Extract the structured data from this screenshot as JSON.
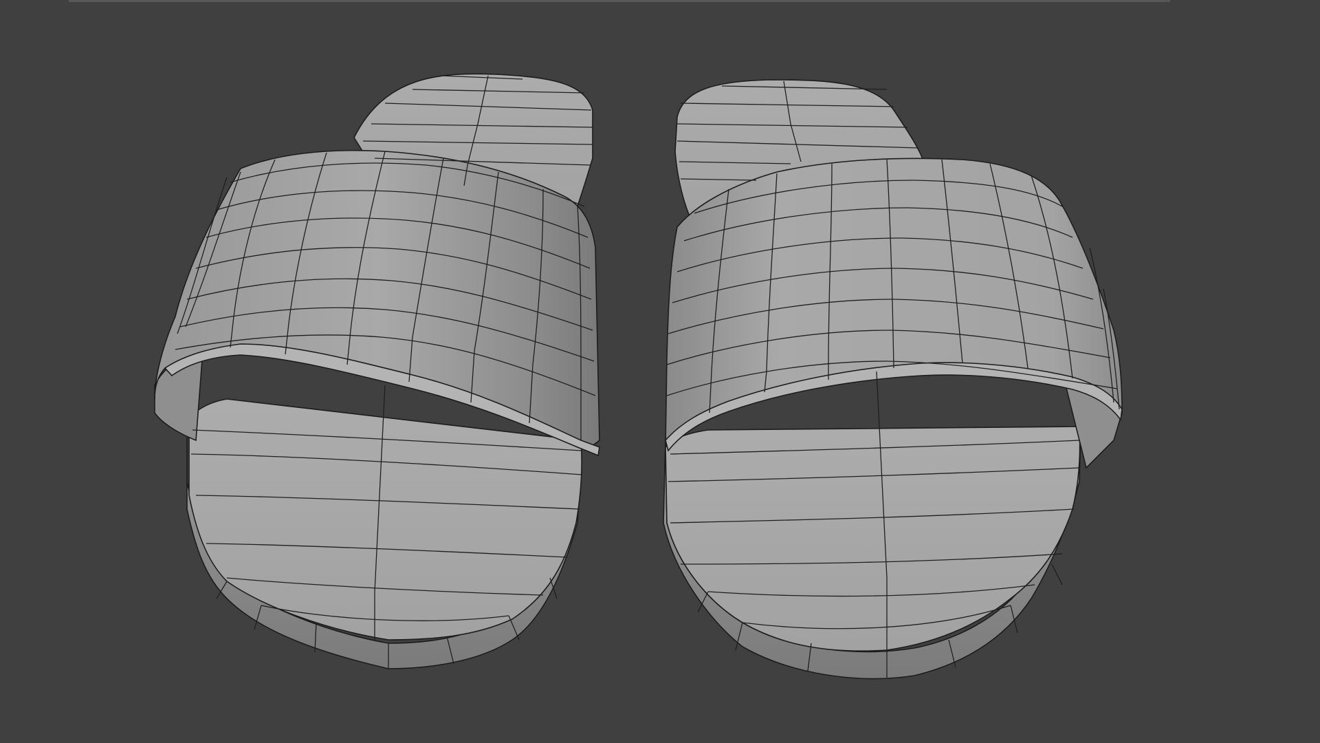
{
  "app": {
    "name": "",
    "view": "3D Viewport"
  },
  "scene": {
    "objects": [
      {
        "name": "left-slipper",
        "mode": "wireframe-overlay"
      },
      {
        "name": "right-slipper",
        "mode": "wireframe-overlay"
      }
    ],
    "colors": {
      "background": "#404040",
      "mesh_fill": "#a7a7a7",
      "mesh_shadow": "#858585",
      "wire": "#1f1f1f"
    }
  }
}
